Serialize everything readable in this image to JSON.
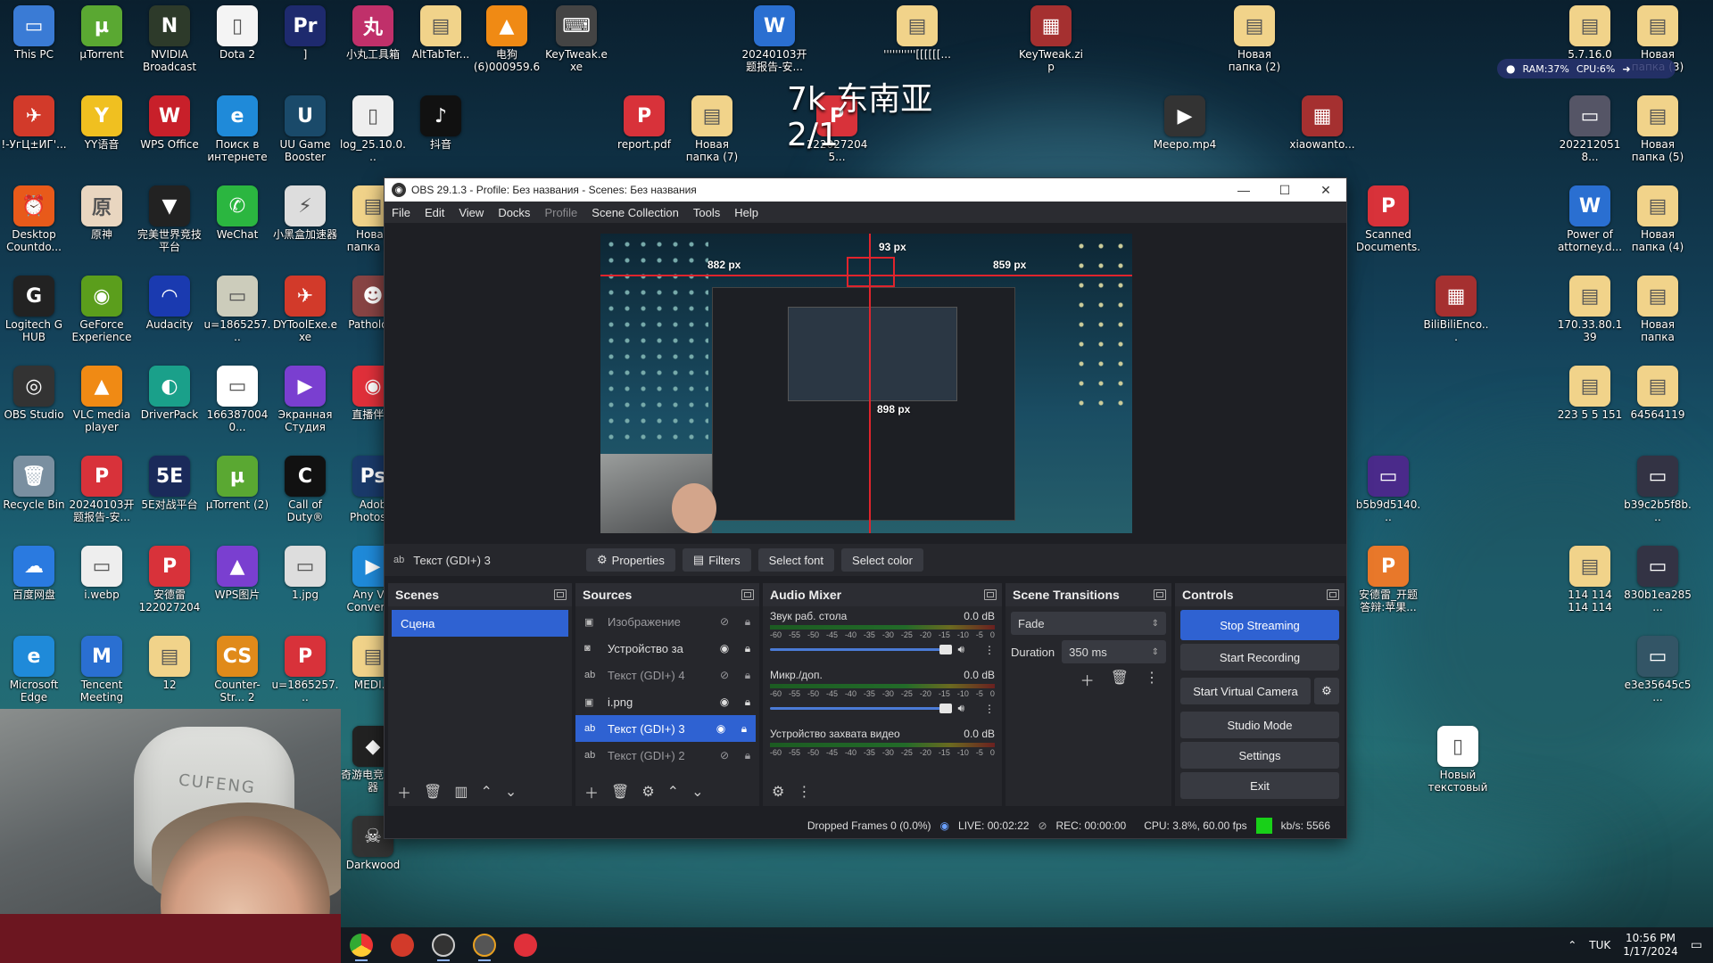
{
  "desktop": {
    "overlay_line1": "7k 东南亚",
    "overlay_line2": "2/1",
    "sysmon": {
      "ram": "RAM:37%",
      "cpu": "CPU:6%"
    },
    "icons": [
      {
        "label": "This PC",
        "color": "#3a7bd5",
        "glyph": "▭"
      },
      {
        "label": "µTorrent",
        "color": "#5aa832",
        "glyph": "µ"
      },
      {
        "label": "NVIDIA Broadcast",
        "color": "#2d3a2a",
        "glyph": "N"
      },
      {
        "label": "Dota 2",
        "color": "#f4f4f4",
        "glyph": "▯"
      },
      {
        "label": "]",
        "color": "#1e2a6e",
        "glyph": "Pr"
      },
      {
        "label": "小丸工具箱",
        "color": "#c0306a",
        "glyph": "丸"
      },
      {
        "label": "AltTabTer...",
        "color": "#f1d38a",
        "glyph": "▤"
      },
      {
        "label": "电狗 (6)000959.6...",
        "color": "#f08a14",
        "glyph": "▲"
      },
      {
        "label": "KeyTweak.exe",
        "color": "#444",
        "glyph": "⌨"
      },
      {
        "label": "20240103开题报告-安...",
        "color": "#2a6fd1",
        "glyph": "W"
      },
      {
        "label": "'''''''''''[[[[[[...",
        "color": "#f1d38a",
        "glyph": "▤"
      },
      {
        "label": "KeyTweak.zip",
        "color": "#a53030",
        "glyph": "▦"
      },
      {
        "label": "Новая папка (2)",
        "color": "#f1d38a",
        "glyph": "▤"
      },
      {
        "label": "5.7.16.0",
        "color": "#f1d38a",
        "glyph": "▤"
      },
      {
        "label": "Новая папка (3)",
        "color": "#f1d38a",
        "glyph": "▤"
      },
      {
        "label": "!-УгЦ±ИГ'...",
        "color": "#d23a2a",
        "glyph": "✈"
      },
      {
        "label": "YY语音",
        "color": "#f0c020",
        "glyph": "Y"
      },
      {
        "label": "WPS Office",
        "color": "#c8202a",
        "glyph": "W"
      },
      {
        "label": "Поиск в интернете",
        "color": "#1f8ad9",
        "glyph": "e"
      },
      {
        "label": "UU Game Booster",
        "color": "#1a4a6a",
        "glyph": "U"
      },
      {
        "label": "log_25.10.0...",
        "color": "#eee",
        "glyph": "▯"
      },
      {
        "label": "抖音",
        "color": "#111",
        "glyph": "♪"
      },
      {
        "label": "report.pdf",
        "color": "#d8323a",
        "glyph": "P"
      },
      {
        "label": "Новая папка (7)",
        "color": "#f1d38a",
        "glyph": "▤"
      },
      {
        "label": "1220272045...",
        "color": "#d8323a",
        "glyph": "P"
      },
      {
        "label": "Meepo.mp4",
        "color": "#333",
        "glyph": "▶"
      },
      {
        "label": "xiaowanto...",
        "color": "#a53030",
        "glyph": "▦"
      },
      {
        "label": "2022120518...",
        "color": "#556",
        "glyph": "▭"
      },
      {
        "label": "Новая папка (5)",
        "color": "#f1d38a",
        "glyph": "▤"
      },
      {
        "label": "Desktop Countdo...",
        "color": "#e85a1a",
        "glyph": "⏰"
      },
      {
        "label": "原神",
        "color": "#e9d6c0",
        "glyph": "原"
      },
      {
        "label": "完美世界竞技平台",
        "color": "#222",
        "glyph": "▼"
      },
      {
        "label": "WeChat",
        "color": "#2bb640",
        "glyph": "✆"
      },
      {
        "label": "小黑盒加速器",
        "color": "#ddd",
        "glyph": "⚡"
      },
      {
        "label": "Новая папка (6)",
        "color": "#f1d38a",
        "glyph": "▤"
      },
      {
        "label": "Scanned Documents...",
        "color": "#d8323a",
        "glyph": "P"
      },
      {
        "label": "Power of attorney.d...",
        "color": "#2a6fd1",
        "glyph": "W"
      },
      {
        "label": "Новая папка (4)",
        "color": "#f1d38a",
        "glyph": "▤"
      },
      {
        "label": "Logitech G HUB",
        "color": "#222",
        "glyph": "G"
      },
      {
        "label": "GeForce Experience",
        "color": "#5b9e1c",
        "glyph": "◉"
      },
      {
        "label": "Audacity",
        "color": "#1a3ab0",
        "glyph": "◠"
      },
      {
        "label": "u=1865257...",
        "color": "#ccb",
        "glyph": "▭"
      },
      {
        "label": "DYToolExe.exe",
        "color": "#d23a2a",
        "glyph": "✈"
      },
      {
        "label": "Patholo...",
        "color": "#844",
        "glyph": "☻"
      },
      {
        "label": "BiliBiliEnco...",
        "color": "#a53030",
        "glyph": "▦"
      },
      {
        "label": "170.33.80.139",
        "color": "#f1d38a",
        "glyph": "▤"
      },
      {
        "label": "Новая папка",
        "color": "#f1d38a",
        "glyph": "▤"
      },
      {
        "label": "OBS Studio",
        "color": "#333",
        "glyph": "◎"
      },
      {
        "label": "VLC media player",
        "color": "#f08a14",
        "glyph": "▲"
      },
      {
        "label": "DriverPack",
        "color": "#1aa08a",
        "glyph": "◐"
      },
      {
        "label": "1663870040...",
        "color": "#fff",
        "glyph": "▭"
      },
      {
        "label": "Экранная Студия",
        "color": "#7a3fd0",
        "glyph": "▶"
      },
      {
        "label": "直播伴...",
        "color": "#e0303a",
        "glyph": "◉"
      },
      {
        "label": "223 5 5 151",
        "color": "#f1d38a",
        "glyph": "▤"
      },
      {
        "label": "64564119",
        "color": "#f1d38a",
        "glyph": "▤"
      },
      {
        "label": "Recycle Bin",
        "color": "#7a8fa0",
        "glyph": "🗑"
      },
      {
        "label": "20240103开题报告-安...",
        "color": "#d8323a",
        "glyph": "P"
      },
      {
        "label": "5E对战平台",
        "color": "#1a2a5a",
        "glyph": "5E"
      },
      {
        "label": "µTorrent (2)",
        "color": "#5aa832",
        "glyph": "µ"
      },
      {
        "label": "Call of Duty®",
        "color": "#111",
        "glyph": "C"
      },
      {
        "label": "Adob Photos...",
        "color": "#1a3a6a",
        "glyph": "Ps"
      },
      {
        "label": "b5b9d5140...",
        "color": "#4a2a8a",
        "glyph": "▭"
      },
      {
        "label": "b39c2b5f8b...",
        "color": "#334",
        "glyph": "▭"
      },
      {
        "label": "百度网盘",
        "color": "#2a7ae0",
        "glyph": "☁"
      },
      {
        "label": "i.webp",
        "color": "#eee",
        "glyph": "▭"
      },
      {
        "label": "安德雷1220272045...",
        "color": "#d8323a",
        "glyph": "P"
      },
      {
        "label": "WPS图片",
        "color": "#7a3fd0",
        "glyph": "▲"
      },
      {
        "label": "1.jpg",
        "color": "#ddd",
        "glyph": "▭"
      },
      {
        "label": "Any Vic Convert...",
        "color": "#1f8ad9",
        "glyph": "▶"
      },
      {
        "label": "安德雷_开题答辩:苹果...",
        "color": "#e8782a",
        "glyph": "P"
      },
      {
        "label": "114 114 114 114",
        "color": "#f1d38a",
        "glyph": "▤"
      },
      {
        "label": "830b1ea285...",
        "color": "#334",
        "glyph": "▭"
      },
      {
        "label": "Microsoft Edge",
        "color": "#1f8ad9",
        "glyph": "e"
      },
      {
        "label": "Tencent Meeting",
        "color": "#2a6fd1",
        "glyph": "M"
      },
      {
        "label": "12",
        "color": "#f1d38a",
        "glyph": "▤"
      },
      {
        "label": "Counter-Str... 2",
        "color": "#e08a1a",
        "glyph": "CS"
      },
      {
        "label": "u=1865257...",
        "color": "#d8323a",
        "glyph": "P"
      },
      {
        "label": "MEDI...",
        "color": "#f1d38a",
        "glyph": "▤"
      },
      {
        "label": "e3e35645c5...",
        "color": "#356",
        "glyph": "▭"
      },
      {
        "label": "Новый текстовый ...",
        "color": "#fff",
        "glyph": "▯"
      },
      {
        "label": "奇游电竞加速器",
        "color": "#222",
        "glyph": "◆"
      },
      {
        "label": "Darkwood",
        "color": "#333",
        "glyph": "☠"
      }
    ]
  },
  "obs": {
    "title": "OBS 29.1.3 - Profile: Без названия - Scenes: Без названия",
    "menu": [
      "File",
      "Edit",
      "View",
      "Docks",
      "Profile",
      "Scene Collection",
      "Tools",
      "Help"
    ],
    "preview_labels": {
      "top": "93 px",
      "left": "882 px",
      "right": "859 px",
      "bottom": "898 px"
    },
    "selected_source": "Текст (GDI+) 3",
    "prop_buttons": {
      "properties": "Properties",
      "filters": "Filters",
      "font": "Select font",
      "color": "Select color"
    },
    "scenes": {
      "title": "Scenes",
      "items": [
        "Сцена"
      ]
    },
    "sources": {
      "title": "Sources",
      "items": [
        {
          "name": "Изображение",
          "type": "img",
          "visible": false
        },
        {
          "name": "Устройство за",
          "type": "cam",
          "visible": true
        },
        {
          "name": "Текст (GDI+) 4",
          "type": "text",
          "visible": false
        },
        {
          "name": "i.png",
          "type": "img",
          "visible": true
        },
        {
          "name": "Текст (GDI+) 3",
          "type": "text",
          "visible": true
        },
        {
          "name": "Текст (GDI+) 2",
          "type": "text",
          "visible": false
        }
      ]
    },
    "mixer": {
      "title": "Audio Mixer",
      "channels": [
        {
          "name": "Звук раб. стола",
          "db": "0.0 dB"
        },
        {
          "name": "Микр./доп.",
          "db": "0.0 dB"
        },
        {
          "name": "Устройство захвата видео",
          "db": "0.0 dB"
        }
      ],
      "ticks": [
        "-60",
        "-55",
        "-50",
        "-45",
        "-40",
        "-35",
        "-30",
        "-25",
        "-20",
        "-15",
        "-10",
        "-5",
        "0"
      ]
    },
    "transitions": {
      "title": "Scene Transitions",
      "type": "Fade",
      "duration_label": "Duration",
      "duration": "350 ms"
    },
    "controls": {
      "title": "Controls",
      "buttons": [
        "Stop Streaming",
        "Start Recording",
        "Start Virtual Camera",
        "Studio Mode",
        "Settings",
        "Exit"
      ]
    },
    "status": {
      "dropped": "Dropped Frames 0 (0.0%)",
      "live": "LIVE: 00:02:22",
      "rec": "REC: 00:00:00",
      "cpu": "CPU: 3.8%, 60.00 fps",
      "kbs": "kb/s: 5566"
    }
  },
  "taskbar": {
    "lang": "TUK",
    "time": "10:56 PM",
    "date": "1/17/2024"
  }
}
